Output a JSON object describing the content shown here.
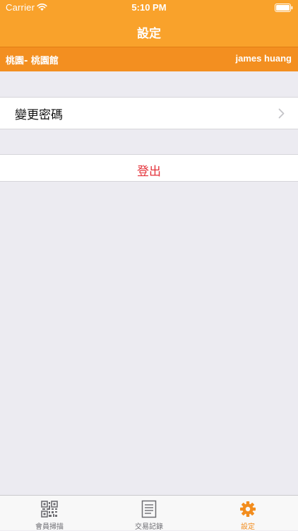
{
  "status_bar": {
    "carrier": "Carrier",
    "time": "5:10 PM"
  },
  "nav": {
    "title": "設定"
  },
  "user_strip": {
    "branch": "桃園- 桃園館",
    "user": "james huang"
  },
  "settings": {
    "change_password_label": "變更密碼",
    "logout_label": "登出"
  },
  "tab_bar": {
    "tabs": [
      {
        "label": "會員掃描",
        "icon": "qr-scan-icon"
      },
      {
        "label": "交易記錄",
        "icon": "document-icon"
      },
      {
        "label": "設定",
        "icon": "gear-icon",
        "selected": true
      }
    ]
  },
  "colors": {
    "header_orange": "#F9A22B",
    "strip_orange": "#F38F20",
    "logout_red": "#E4333B",
    "active_tab": "#F28D1E",
    "inactive_tab": "#6D6D72",
    "background": "#ECEBF1"
  }
}
